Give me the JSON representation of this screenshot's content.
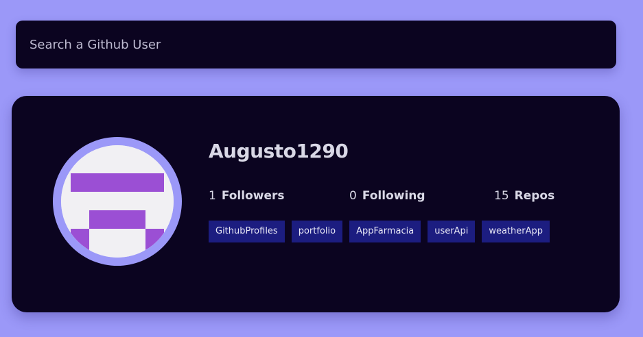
{
  "search": {
    "placeholder": "Search a Github User"
  },
  "profile": {
    "username": "Augusto1290",
    "avatar_icon": "identicon-avatar",
    "stats": {
      "followers_count": "1",
      "followers_label": "Followers",
      "following_count": "0",
      "following_label": "Following",
      "repos_count": "15",
      "repos_label": "Repos"
    },
    "repos": [
      {
        "name": "GithubProfiles"
      },
      {
        "name": "portfolio"
      },
      {
        "name": "AppFarmacia"
      },
      {
        "name": "userApi"
      },
      {
        "name": "weatherApp"
      }
    ]
  },
  "colors": {
    "background": "#9b98f8",
    "card": "#0b0420",
    "repo_tag": "#1c1d80",
    "identicon": "#9b4fd4"
  }
}
